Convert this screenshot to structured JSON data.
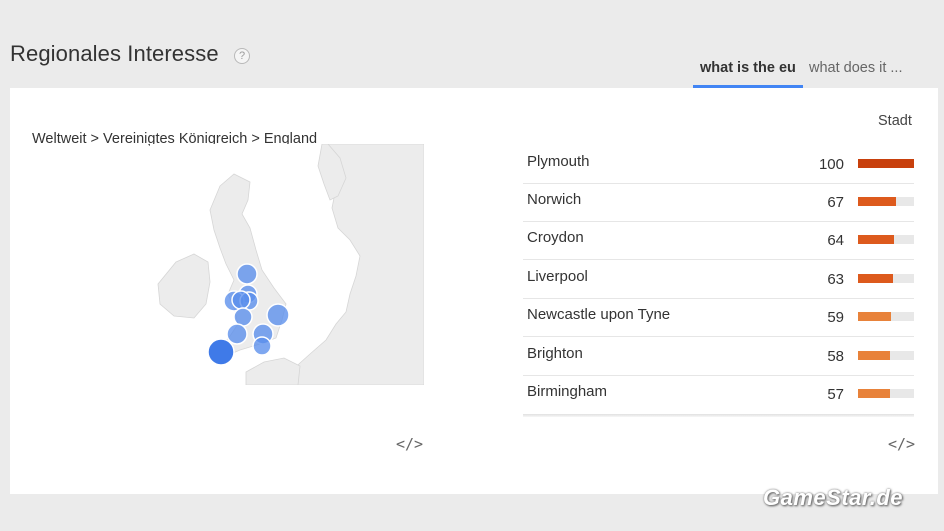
{
  "header": {
    "title": "Regionales Interesse",
    "help_icon": "?",
    "tabs": [
      {
        "label": "what is the eu",
        "active": true
      },
      {
        "label": "what does it ...",
        "active": false
      }
    ]
  },
  "map": {
    "breadcrumb": "Weltweit > Vereinigtes Königreich > England",
    "embed_label": "</>"
  },
  "list": {
    "column_header": "Stadt",
    "embed_label": "</>",
    "rows": [
      {
        "name": "Plymouth",
        "value": "100",
        "pct": 100,
        "color": "#c8400c"
      },
      {
        "name": "Norwich",
        "value": "67",
        "pct": 67,
        "color": "#dd5a1d"
      },
      {
        "name": "Croydon",
        "value": "64",
        "pct": 64,
        "color": "#dd5a1d"
      },
      {
        "name": "Liverpool",
        "value": "63",
        "pct": 63,
        "color": "#dd5a1d"
      },
      {
        "name": "Newcastle upon Tyne",
        "value": "59",
        "pct": 59,
        "color": "#e8823a"
      },
      {
        "name": "Brighton",
        "value": "58",
        "pct": 58,
        "color": "#e8823a"
      },
      {
        "name": "Birmingham",
        "value": "57",
        "pct": 57,
        "color": "#e8823a"
      }
    ]
  },
  "watermark": "GameStar.de"
}
